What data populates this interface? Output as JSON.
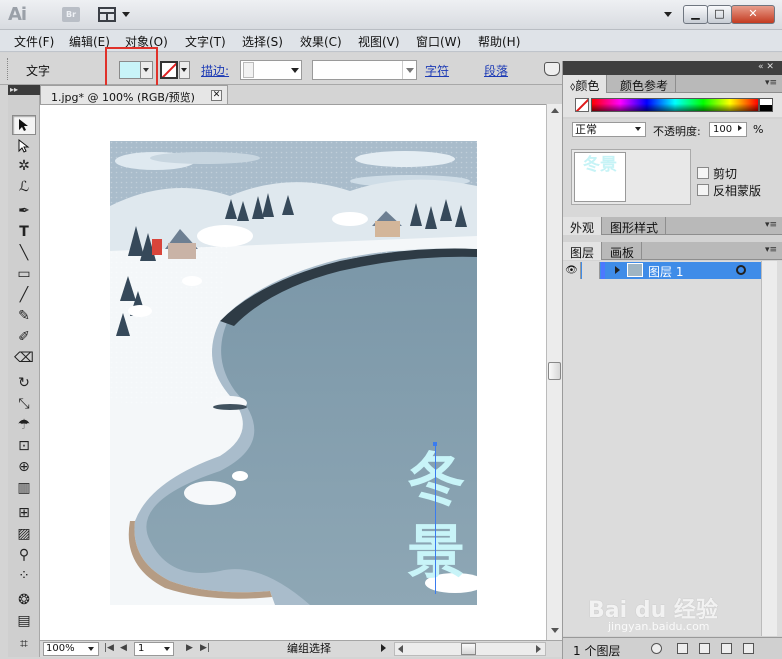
{
  "titlebar": {
    "app_logo": "Ai",
    "bridge_label": "Br",
    "minimize": "▁",
    "maximize": "□",
    "close": "✕"
  },
  "menu": [
    "文件(F)",
    "编辑(E)",
    "对象(O)",
    "文字(T)",
    "选择(S)",
    "效果(C)",
    "视图(V)",
    "窗口(W)",
    "帮助(H)"
  ],
  "control_bar": {
    "tool_label": "文字",
    "fill_color": "#c8f4f8",
    "stroke_label": "描边:",
    "character_link": "字符",
    "paragraph_link": "段落"
  },
  "document": {
    "tab_title": "1.jpg* @ 100% (RGB/预览)",
    "artwork_text": [
      "冬",
      "景"
    ],
    "artwork_text_color": "#c8f4f8"
  },
  "status_bar": {
    "zoom": "100%",
    "page": "1",
    "status_text": "编组选择"
  },
  "panels": {
    "color_tab": "颜色",
    "color_guide_tab": "颜色参考",
    "blend_mode": "正常",
    "opacity_label": "不透明度:",
    "opacity_value": "100",
    "opacity_unit": "%",
    "clip_label": "剪切",
    "invert_mask_label": "反相蒙版",
    "appearance_tab": "外观",
    "graphic_styles_tab": "图形样式",
    "layers_tab": "图层",
    "artboards_tab": "画板",
    "layer_name": "图层 1",
    "layer_count": "1 个图层",
    "thumb_chars": "冬景"
  },
  "watermark": {
    "logo": "Bai du 经验",
    "url": "jingyan.baidu.com"
  }
}
